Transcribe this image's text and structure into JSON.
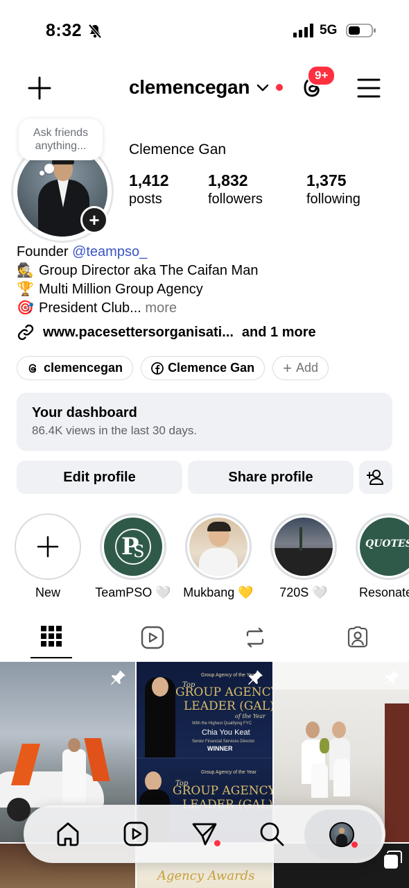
{
  "status_bar": {
    "time": "8:32",
    "network": "5G"
  },
  "header": {
    "username": "clemencegan",
    "notifications_badge": "9+"
  },
  "profile": {
    "note_placeholder": "Ask friends anything...",
    "full_name": "Clemence Gan",
    "stats": [
      {
        "value": "1,412",
        "label": "posts"
      },
      {
        "value": "1,832",
        "label": "followers"
      },
      {
        "value": "1,375",
        "label": "following"
      }
    ],
    "bio": {
      "founder_prefix": "Founder ",
      "founder_mention": "@teampso_",
      "line2": "Group Director aka The Caifan Man",
      "line3": "Multi Million Group Agency",
      "line4": "President Club...",
      "more": "more"
    },
    "link": {
      "url": "www.pacesettersorganisati...",
      "extra": "and 1 more"
    },
    "chips": {
      "threads": "clemencegan",
      "facebook": "Clemence Gan",
      "add": "Add"
    }
  },
  "dashboard": {
    "title": "Your dashboard",
    "subtitle": "86.4K views in the last 30 days."
  },
  "actions": {
    "edit": "Edit profile",
    "share": "Share profile"
  },
  "highlights": [
    {
      "label": "New"
    },
    {
      "label": "TeamPSO 🤍"
    },
    {
      "label": "Mukbang 💛"
    },
    {
      "label": "720S 🤍"
    },
    {
      "label": "Resonates"
    }
  ],
  "grid_text": {
    "post2_kicker": "Group Agency of the Year",
    "post2_title1": "Top",
    "post2_title2": "GROUP AGENCY",
    "post2_title3": "LEADER (GAL)",
    "post2_title4": "of the Year",
    "post2_sub": "With the Highest Qualifying FYC",
    "post2_name": "Chia You Keat",
    "post2_role": "Senior Financial Services Director",
    "post2_winner": "WINNER",
    "post2b_kicker": "Group Agency of the Year",
    "post2b_title1": "Top",
    "post2b_title2": "GROUP AGENCY",
    "post2b_title3": "LEADER (GAL)",
    "highlight_quotes": "QUOTES",
    "bottom_partial": "Agency Awards"
  },
  "colors": {
    "accent_red": "#ff3040",
    "mention_blue": "#3a53c4",
    "surface": "#eff1f4"
  }
}
